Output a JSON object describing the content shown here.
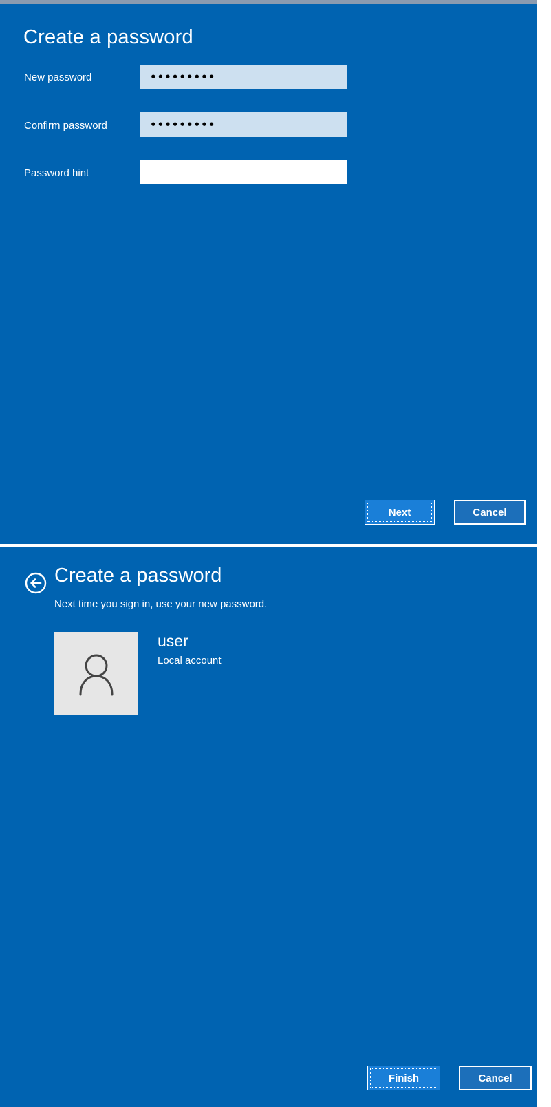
{
  "step1": {
    "title": "Create a password",
    "fields": [
      {
        "label": "New password",
        "value": "•••••••••"
      },
      {
        "label": "Confirm password",
        "value": "•••••••••"
      },
      {
        "label": "Password hint",
        "value": ""
      }
    ],
    "next_label": "Next",
    "cancel_label": "Cancel"
  },
  "step2": {
    "title": "Create a password",
    "subtitle": "Next time you sign in, use your new password.",
    "user": {
      "name": "user",
      "account_type": "Local account"
    },
    "finish_label": "Finish",
    "cancel_label": "Cancel"
  },
  "colors": {
    "background": "#0063B1",
    "text": "#FFFFFF",
    "password_field": "#CDE0F0",
    "avatar_bg": "#E6E6E6"
  },
  "icons": {
    "back": "back-arrow-circle-icon",
    "avatar": "person-outline-icon"
  }
}
